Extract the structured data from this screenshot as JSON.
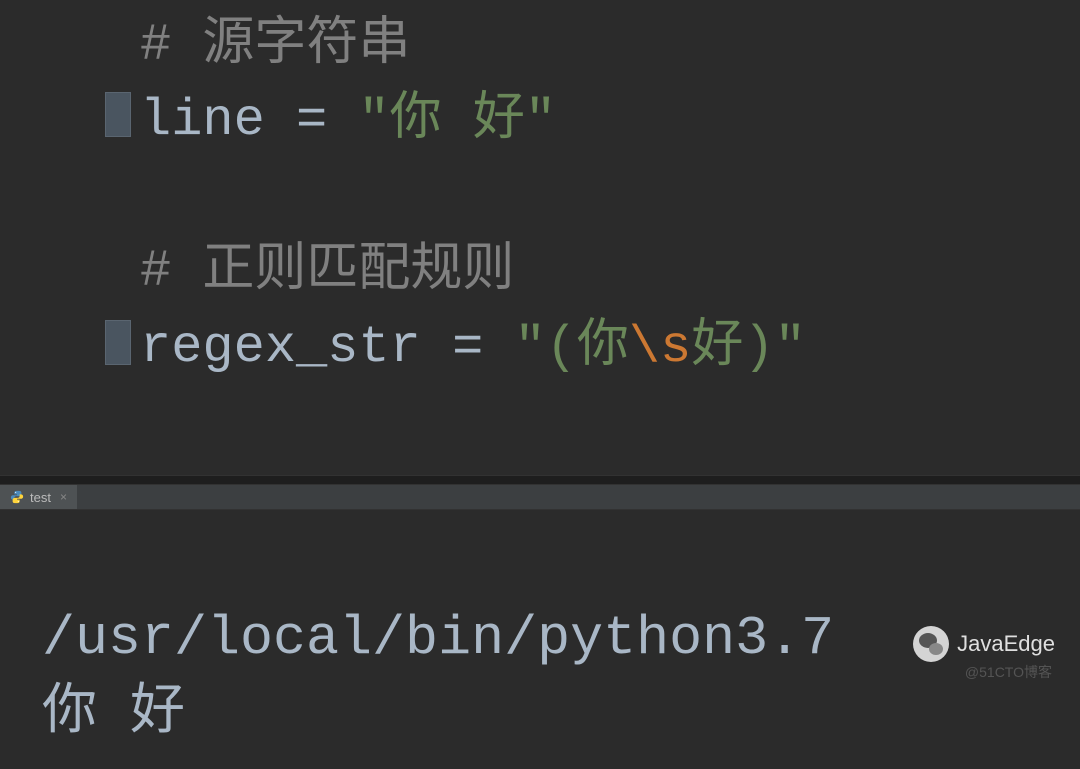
{
  "editor": {
    "lines": {
      "comment1": "# 源字符串",
      "var1": "line",
      "eq1": " = ",
      "str1_open": "\"",
      "str1_content": "你 好",
      "str1_close": "\"",
      "comment2": "# 正则匹配规则",
      "var2": "regex_str",
      "eq2": " = ",
      "str2_open": "\"",
      "str2_p1": "(你",
      "str2_esc": "\\s",
      "str2_p2": "好)",
      "str2_close": "\""
    }
  },
  "tab": {
    "name": "test"
  },
  "console": {
    "line1": "/usr/local/bin/python3.7",
    "line2": "你 好"
  },
  "watermark": {
    "wechat": "JavaEdge",
    "blog": "@51CTO博客"
  }
}
